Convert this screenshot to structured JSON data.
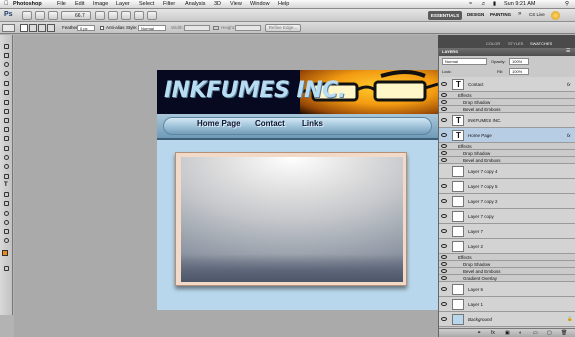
{
  "menubar": {
    "app": "Photoshop",
    "items": [
      "File",
      "Edit",
      "Image",
      "Layer",
      "Select",
      "Filter",
      "Analysis",
      "3D",
      "View",
      "Window",
      "Help"
    ],
    "clock": "Sun 9:21 AM"
  },
  "appbar": {
    "logo": "Ps",
    "zoom": "66.7",
    "workspaces": [
      "ESSENTIALS",
      "DESIGN",
      "PAINTING"
    ],
    "more": "»",
    "cs_live": "CS Live"
  },
  "options": {
    "feather_label": "Feather:",
    "feather_value": "0 px",
    "antialias_label": "Anti-alias",
    "style_label": "Style:",
    "style_value": "Normal",
    "width_label": "Width:",
    "height_label": "Height:",
    "refine_label": "Refine Edge..."
  },
  "document": {
    "banner_title": "INKFUMES INC.",
    "nav": [
      "Home Page",
      "Contact",
      "Links"
    ]
  },
  "panel_tabs": [
    "COLOR",
    "STYLES",
    "SWATCHES"
  ],
  "layers_panel": {
    "title": "LAYERS",
    "blend_mode": "Normal",
    "opacity_label": "Opacity:",
    "opacity_value": "100%",
    "fill_label": "Fill:",
    "fill_value": "100%",
    "lock_label": "Lock:",
    "rows": [
      {
        "name": "Contact",
        "type": "text",
        "visible": true
      },
      {
        "name": "Effects",
        "type": "effects",
        "visible": true
      },
      {
        "name": "Drop Shadow",
        "type": "effect",
        "visible": true
      },
      {
        "name": "Bevel and Emboss",
        "type": "effect",
        "visible": true
      },
      {
        "name": "INKFUMES INC.",
        "type": "text",
        "visible": true
      },
      {
        "name": "Home Page",
        "type": "text",
        "visible": true,
        "selected": true
      },
      {
        "name": "Effects",
        "type": "effects",
        "visible": true
      },
      {
        "name": "Drop Shadow",
        "type": "effect",
        "visible": true
      },
      {
        "name": "Bevel and Emboss",
        "type": "effect",
        "visible": true
      },
      {
        "name": "Layer 7 copy 4",
        "type": "layer",
        "visible": false
      },
      {
        "name": "Layer 7 copy 5",
        "type": "layer",
        "visible": true
      },
      {
        "name": "Layer 7 copy 2",
        "type": "layer",
        "visible": true
      },
      {
        "name": "Layer 7 copy",
        "type": "layer",
        "visible": true
      },
      {
        "name": "Layer 7",
        "type": "layer",
        "visible": true
      },
      {
        "name": "Layer 2",
        "type": "layer",
        "visible": true
      },
      {
        "name": "Effects",
        "type": "effects",
        "visible": true
      },
      {
        "name": "Drop Shadow",
        "type": "effect",
        "visible": true
      },
      {
        "name": "Bevel and Emboss",
        "type": "effect",
        "visible": true
      },
      {
        "name": "Gradient Overlay",
        "type": "effect",
        "visible": true
      },
      {
        "name": "Layer 6",
        "type": "layer",
        "visible": true
      },
      {
        "name": "Layer 1",
        "type": "layer",
        "visible": true
      },
      {
        "name": "Background",
        "type": "layer",
        "visible": true
      }
    ]
  },
  "colors": {
    "menubar": "#e8e8e8",
    "banner_bg": "#06091f",
    "banner_text": "#b8ddf2",
    "nav_bg": "#7fa9c4",
    "content_bg": "#b9d7ec",
    "selected_layer": "#b7cde4",
    "foreground_swatch": "#ea8a1a"
  }
}
